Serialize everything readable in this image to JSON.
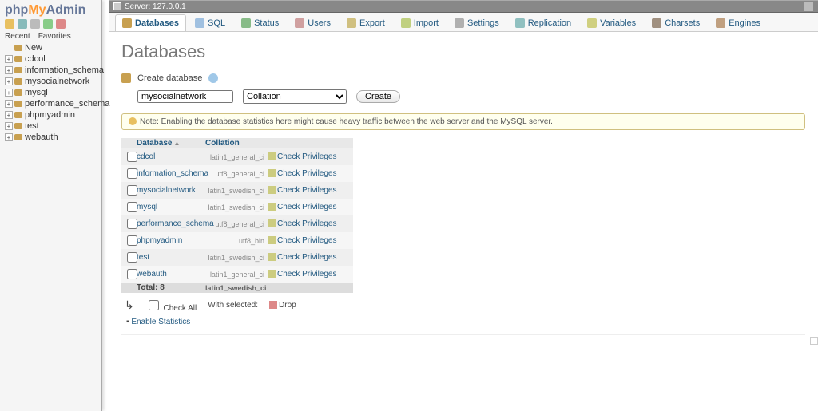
{
  "server": {
    "label": "Server: 127.0.0.1",
    "close": "×"
  },
  "logo": {
    "p1": "php",
    "p2": "My",
    "p3": "Admin"
  },
  "navTabs": {
    "recent": "Recent",
    "favorites": "Favorites"
  },
  "navTree": {
    "new": "New",
    "items": [
      "cdcol",
      "information_schema",
      "mysocialnetwork",
      "mysql",
      "performance_schema",
      "phpmyadmin",
      "test",
      "webauth"
    ]
  },
  "topTabs": {
    "databases": "Databases",
    "sql": "SQL",
    "status": "Status",
    "users": "Users",
    "export": "Export",
    "import": "Import",
    "settings": "Settings",
    "replication": "Replication",
    "variables": "Variables",
    "charsets": "Charsets",
    "engines": "Engines"
  },
  "page": {
    "title": "Databases",
    "createLabel": "Create database",
    "dbInputValue": "mysocialnetwork",
    "collationPlaceholder": "Collation",
    "createButton": "Create",
    "notice": "Note: Enabling the database statistics here might cause heavy traffic between the web server and the MySQL server."
  },
  "table": {
    "headers": {
      "database": "Database",
      "collation": "Collation"
    },
    "privLabel": "Check Privileges",
    "rows": [
      {
        "name": "cdcol",
        "collation": "latin1_general_ci"
      },
      {
        "name": "information_schema",
        "collation": "utf8_general_ci"
      },
      {
        "name": "mysocialnetwork",
        "collation": "latin1_swedish_ci"
      },
      {
        "name": "mysql",
        "collation": "latin1_swedish_ci"
      },
      {
        "name": "performance_schema",
        "collation": "utf8_general_ci"
      },
      {
        "name": "phpmyadmin",
        "collation": "utf8_bin"
      },
      {
        "name": "test",
        "collation": "latin1_swedish_ci"
      },
      {
        "name": "webauth",
        "collation": "latin1_general_ci"
      }
    ],
    "footer": {
      "total": "Total: 8",
      "collation": "latin1_swedish_ci"
    }
  },
  "below": {
    "checkAll": "Check All",
    "withSelected": "With selected:",
    "drop": "Drop"
  },
  "enableStats": "Enable Statistics"
}
